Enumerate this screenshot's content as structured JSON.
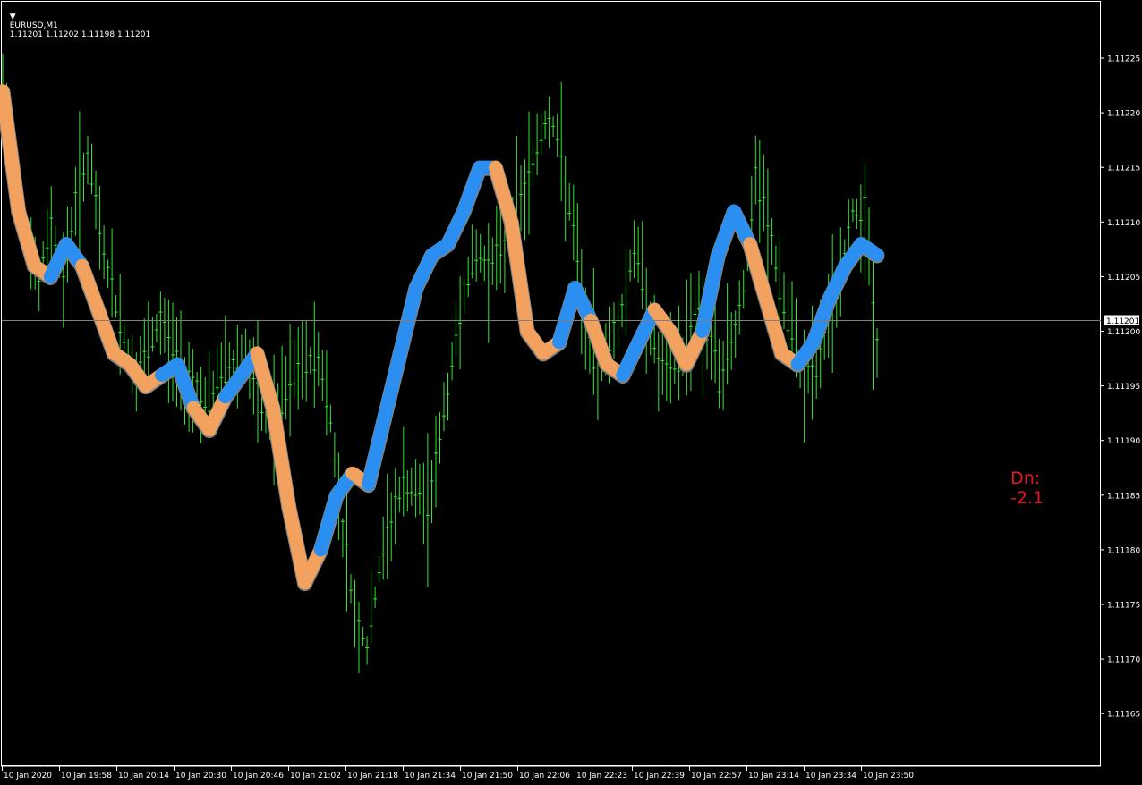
{
  "header": {
    "symbol_timeframe": "EURUSD,M1",
    "ohlc": "1.11201 1.11202 1.11198 1.11201",
    "menu_glyph": "▼"
  },
  "indicator_label": {
    "prefix": "Dn:",
    "value": "-2.1",
    "color": "#e8141e"
  },
  "colors": {
    "background": "#000000",
    "frame": "#ffffff",
    "bars": "#32e632",
    "band_up": "#2a8ff0",
    "band_down": "#f2a25e",
    "band_edge": "#808080",
    "price_line": "#808080"
  },
  "chart_data": {
    "type": "bar",
    "title": "",
    "ylim": [
      1.11161,
      1.11229
    ],
    "y_ticks": [
      "1.11225",
      "1.11220",
      "1.11215",
      "1.11210",
      "1.11205",
      "1.11200",
      "1.11195",
      "1.11190",
      "1.11185",
      "1.11180",
      "1.11175",
      "1.11170",
      "1.11165"
    ],
    "x_ticks": [
      "10 Jan 2020",
      "10 Jan 19:58",
      "10 Jan 20:14",
      "10 Jan 20:30",
      "10 Jan 20:46",
      "10 Jan 21:02",
      "10 Jan 21:18",
      "10 Jan 21:34",
      "10 Jan 21:50",
      "10 Jan 22:06",
      "10 Jan 22:23",
      "10 Jan 22:39",
      "10 Jan 22:57",
      "10 Jan 23:14",
      "10 Jan 23:34",
      "10 Jan 23:50"
    ],
    "current_price": "1.11201",
    "price_series_close": [
      1.11222,
      1.11215,
      1.11209,
      1.11204,
      1.1121,
      1.11205,
      1.11212,
      1.11216,
      1.11209,
      1.11204,
      1.11199,
      1.11196,
      1.11198,
      1.11201,
      1.11198,
      1.11196,
      1.11195,
      1.11193,
      1.11196,
      1.11197,
      1.11198,
      1.11194,
      1.11192,
      1.11193,
      1.11196,
      1.11197,
      1.11198,
      1.11192,
      1.11182,
      1.11174,
      1.11171,
      1.11178,
      1.11183,
      1.11186,
      1.11185,
      1.11184,
      1.1119,
      1.11197,
      1.11204,
      1.11207,
      1.11206,
      1.11208,
      1.1121,
      1.11213,
      1.11217,
      1.1122,
      1.11216,
      1.11209,
      1.112,
      1.11197,
      1.11199,
      1.11202,
      1.11208,
      1.11203,
      1.11197,
      1.11196,
      1.11198,
      1.11202,
      1.112,
      1.11196,
      1.11199,
      1.11204,
      1.11214,
      1.1121,
      1.11204,
      1.11199,
      1.11196,
      1.11196,
      1.11201,
      1.11205,
      1.11211,
      1.11211,
      1.11198
    ],
    "band_series": [
      1.11222,
      1.11211,
      1.11206,
      1.11205,
      1.11208,
      1.11206,
      1.11202,
      1.11198,
      1.11197,
      1.11195,
      1.11196,
      1.11197,
      1.11193,
      1.11191,
      1.11194,
      1.11196,
      1.11198,
      1.11193,
      1.11184,
      1.11177,
      1.1118,
      1.11185,
      1.11187,
      1.11186,
      1.11192,
      1.11198,
      1.11204,
      1.11207,
      1.11208,
      1.11211,
      1.11215,
      1.11215,
      1.1121,
      1.112,
      1.11198,
      1.11199,
      1.11204,
      1.11201,
      1.11197,
      1.11196,
      1.11199,
      1.11202,
      1.112,
      1.11197,
      1.112,
      1.11207,
      1.11211,
      1.11208,
      1.11203,
      1.11198,
      1.11197,
      1.11199,
      1.11203,
      1.11206,
      1.11208,
      1.11207
    ],
    "band_trend": [
      "down",
      "down",
      "down",
      "up",
      "up",
      "down",
      "down",
      "down",
      "down",
      "down",
      "up",
      "up",
      "down",
      "down",
      "up",
      "up",
      "down",
      "down",
      "down",
      "down",
      "up",
      "up",
      "down",
      "up",
      "up",
      "up",
      "up",
      "up",
      "up",
      "up",
      "up",
      "down",
      "down",
      "down",
      "down",
      "up",
      "up",
      "down",
      "down",
      "up",
      "up",
      "down",
      "down",
      "down",
      "up",
      "up",
      "up",
      "down",
      "down",
      "down",
      "up",
      "up",
      "up",
      "up",
      "up",
      "down"
    ]
  }
}
